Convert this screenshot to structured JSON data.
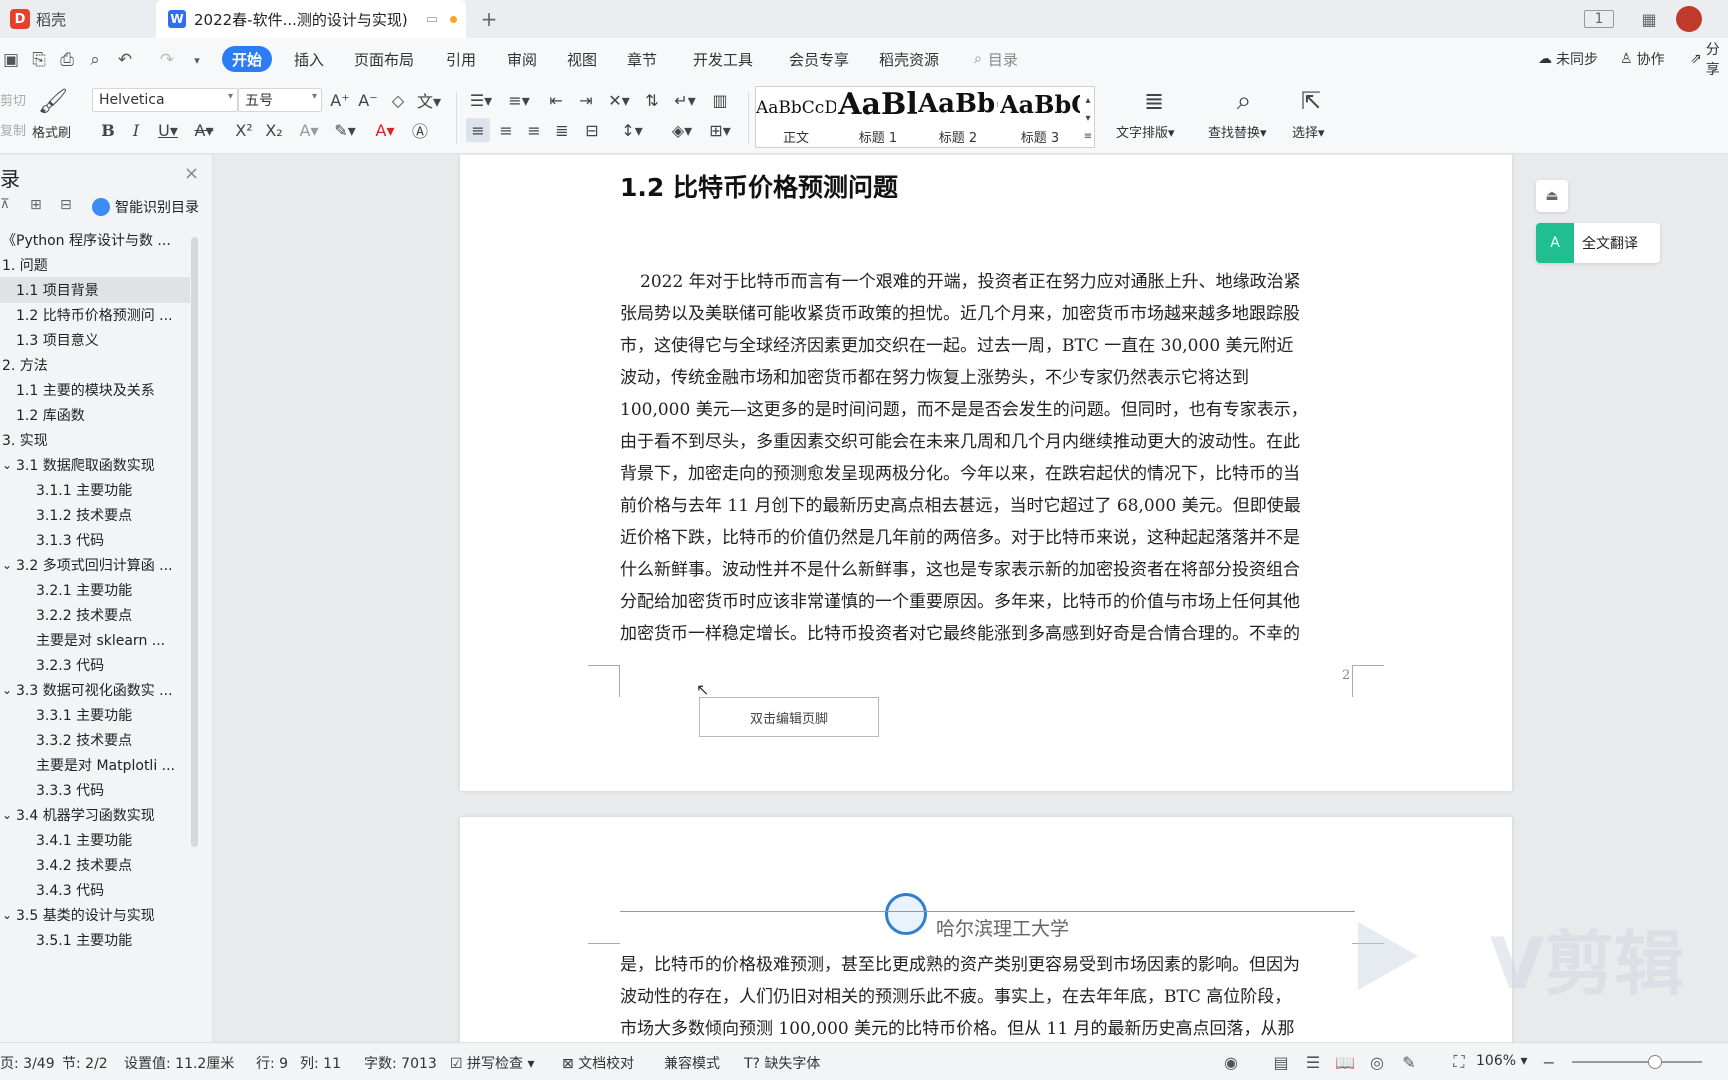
{
  "tabs": {
    "app_label": "稻壳",
    "doc_title": "2022春-软件...测的设计与实现)"
  },
  "menu": {
    "items": [
      "开始",
      "插入",
      "页面布局",
      "引用",
      "审阅",
      "视图",
      "章节",
      "开发工具",
      "会员专享",
      "稻壳资源"
    ],
    "search_placeholder": "目录",
    "sync": "未同步",
    "collab": "协作",
    "share": "分享"
  },
  "ribbon": {
    "cut": "剪切",
    "copy": "复制",
    "format_painter": "格式刷",
    "font": "Helvetica",
    "size": "五号",
    "styles": [
      {
        "preview": "AaBbCcDd",
        "name": "正文"
      },
      {
        "preview": "AaBl",
        "name": "标题 1"
      },
      {
        "preview": "AaBb(",
        "name": "标题 2"
      },
      {
        "preview": "AaBbC",
        "name": "标题 3"
      }
    ],
    "text_layout": "文字排版",
    "find_replace": "查找替换",
    "select": "选择"
  },
  "sidebar": {
    "title": "录",
    "smart_toc": "智能识别目录",
    "toc": [
      {
        "label": "《Python 程序设计与数 ...",
        "indent": 0,
        "sel": false
      },
      {
        "label": "1. 问题",
        "indent": 0,
        "sel": false
      },
      {
        "label": "1.1  项目背景",
        "indent": 1,
        "sel": true
      },
      {
        "label": "1.2  比特币价格预测问 ...",
        "indent": 1,
        "sel": false
      },
      {
        "label": "1.3 项目意义",
        "indent": 1,
        "sel": false
      },
      {
        "label": "2. 方法",
        "indent": 0,
        "sel": false
      },
      {
        "label": "1.1  主要的模块及关系",
        "indent": 1,
        "sel": false
      },
      {
        "label": "1.2 库函数",
        "indent": 1,
        "sel": false
      },
      {
        "label": "3. 实现",
        "indent": 0,
        "sel": false
      },
      {
        "label": "3.1  数据爬取函数实现",
        "indent": 1,
        "sel": false,
        "caret": true
      },
      {
        "label": "3.1.1  主要功能",
        "indent": 2,
        "sel": false
      },
      {
        "label": "3.1.2  技术要点",
        "indent": 2,
        "sel": false
      },
      {
        "label": "3.1.3  代码",
        "indent": 2,
        "sel": false
      },
      {
        "label": "3.2  多项式回归计算函 ...",
        "indent": 1,
        "sel": false,
        "caret": true
      },
      {
        "label": "3.2.1  主要功能",
        "indent": 2,
        "sel": false
      },
      {
        "label": "3.2.2  技术要点",
        "indent": 2,
        "sel": false
      },
      {
        "label": "主要是对 sklearn ...",
        "indent": 2,
        "sel": false
      },
      {
        "label": "3.2.3  代码",
        "indent": 2,
        "sel": false
      },
      {
        "label": "3.3  数据可视化函数实 ...",
        "indent": 1,
        "sel": false,
        "caret": true
      },
      {
        "label": "3.3.1  主要功能",
        "indent": 2,
        "sel": false
      },
      {
        "label": "3.3.2  技术要点",
        "indent": 2,
        "sel": false
      },
      {
        "label": "主要是对 Matplotli ...",
        "indent": 2,
        "sel": false
      },
      {
        "label": "3.3.3  代码",
        "indent": 2,
        "sel": false
      },
      {
        "label": "3.4  机器学习函数实现",
        "indent": 1,
        "sel": false,
        "caret": true
      },
      {
        "label": "3.4.1  主要功能",
        "indent": 2,
        "sel": false
      },
      {
        "label": "3.4.2  技术要点",
        "indent": 2,
        "sel": false
      },
      {
        "label": "3.4.3  代码",
        "indent": 2,
        "sel": false
      },
      {
        "label": "3.5  基类的设计与实现",
        "indent": 1,
        "sel": false,
        "caret": true
      },
      {
        "label": "3.5.1  主要功能",
        "indent": 2,
        "sel": false
      }
    ]
  },
  "document": {
    "heading": "1.2  比特币价格预测问题",
    "page1_lines": [
      "2022 年对于比特币而言有一个艰难的开端，投资者正在努力应对通胀上升、地缘政治紧",
      "张局势以及美联储可能收紧货币政策的担忧。近几个月来，加密货币市场越来越多地跟踪股",
      "市，这使得它与全球经济因素更加交织在一起。过去一周，BTC 一直在  30,000  美元附近",
      "波动，传统金融市场和加密货币都在努力恢复上涨势头，不少专家仍然表示它将达到",
      "100,000  美元—这更多的是时间问题，而不是是否会发生的问题。但同时，也有专家表示，",
      "由于看不到尽头，多重因素交织可能会在未来几周和几个月内继续推动更大的波动性。在此",
      "背景下，加密走向的预测愈发呈现两极分化。今年以来，在跌宕起伏的情况下，比特币的当",
      "前价格与去年 11 月创下的最新历史高点相去甚远，当时它超过了 68,000  美元。但即使最",
      "近价格下跌，比特币的价值仍然是几年前的两倍多。对于比特币来说，这种起起落落并不是",
      "什么新鲜事。波动性并不是什么新鲜事，这也是专家表示新的加密投资者在将部分投资组合",
      "分配给加密货币时应该非常谨慎的一个重要原因。多年来，比特币的价值与市场上任何其他",
      "加密货币一样稳定增长。比特币投资者对它最终能涨到多高感到好奇是合情合理的。不幸的"
    ],
    "page_number": "2",
    "footer_hint": "双击编辑页脚",
    "header_org": "哈尔滨理工大学",
    "page2_lines": [
      "是，比特币的价格极难预测，甚至比更成熟的资产类别更容易受到市场因素的影响。但因为",
      "波动性的存在，人们仍旧对相关的预测乐此不疲。事实上，在去年年底，BTC 高位阶段，",
      "市场大多数倾向预测  100,000  美元的比特币价格。但从  11  月的最新历史高点回落，从那"
    ]
  },
  "right_rail": {
    "translate": "全文翻译"
  },
  "statusbar": {
    "page": "页: 3/49",
    "section": "节: 2/2",
    "setting": "设置值: 11.2厘米",
    "row": "行: 9",
    "col": "列: 11",
    "words": "字数: 7013",
    "spell": "拼写检查",
    "proof": "文档校对",
    "compat": "兼容模式",
    "missing_font": "缺失字体",
    "zoom": "106%"
  },
  "watermark": "V剪辑",
  "colors": {
    "accent": "#2c7cf6",
    "translate_green": "#1fbf8f",
    "app_red": "#e5402c"
  }
}
